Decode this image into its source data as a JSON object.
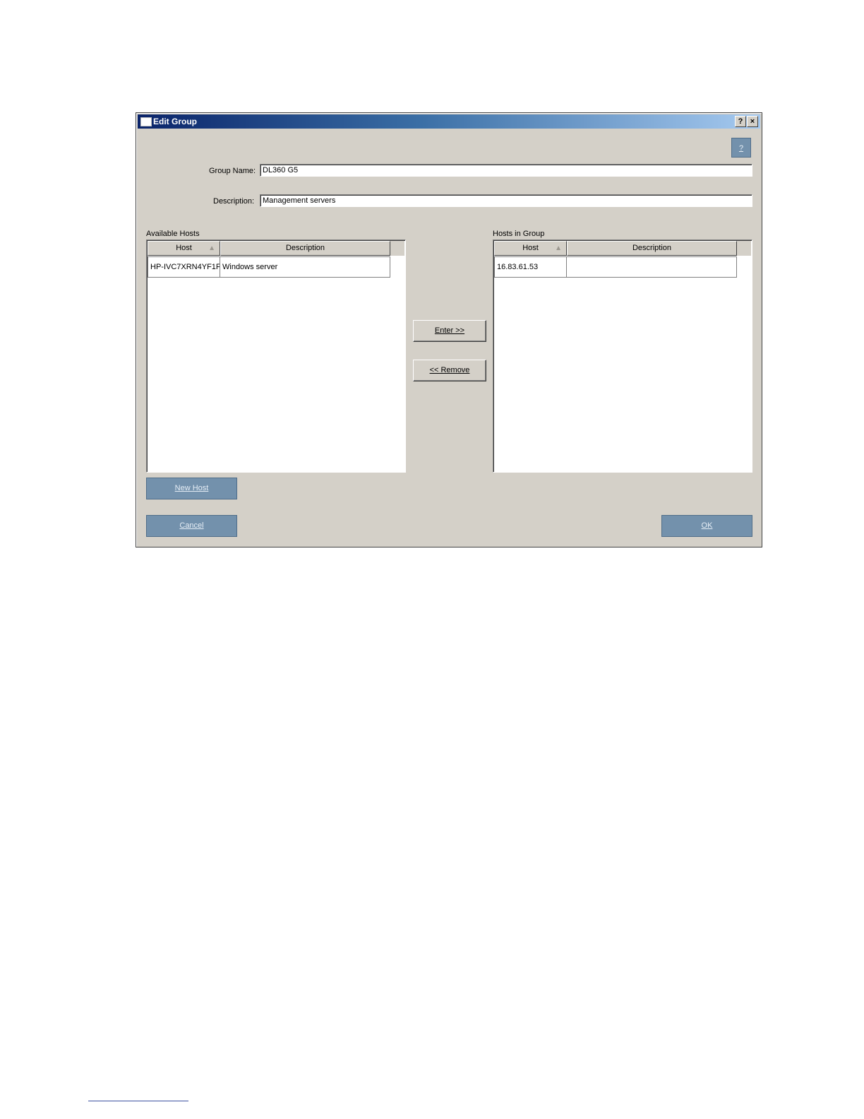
{
  "dialog": {
    "title": "Edit Group",
    "help_button": "?",
    "close_button": "×",
    "context_help": "?"
  },
  "form": {
    "group_name_label": "Group Name:",
    "group_name_value": "DL360 G5",
    "description_label": "Description:",
    "description_value": "Management servers"
  },
  "available_hosts": {
    "label": "Available Hosts",
    "columns": [
      "Host",
      "Description"
    ],
    "sort_indicator": "▲",
    "rows": [
      {
        "host": "HP-IVC7XRN4YF1F",
        "description": "Windows server"
      }
    ]
  },
  "hosts_in_group": {
    "label": "Hosts in Group",
    "columns": [
      "Host",
      "Description"
    ],
    "sort_indicator": "▲",
    "rows": [
      {
        "host": "16.83.61.53",
        "description": ""
      }
    ]
  },
  "buttons": {
    "enter": "Enter >>",
    "remove": "<< Remove",
    "new_host": "New Host",
    "cancel": "Cancel",
    "ok": "OK"
  }
}
